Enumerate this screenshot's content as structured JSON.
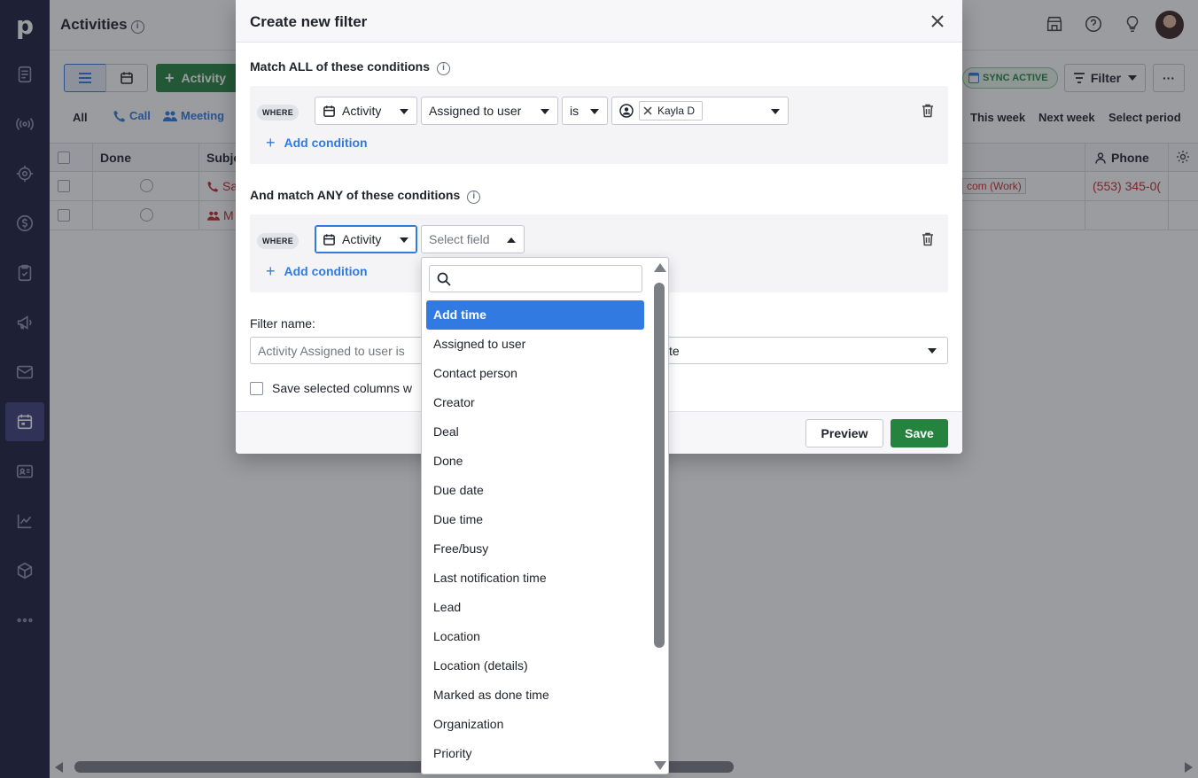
{
  "app": {
    "page_title": "Activities",
    "nav_icons": [
      "logo",
      "deals-icon",
      "leads-icon",
      "projects-icon",
      "revenue-icon",
      "tasks-icon",
      "campaigns-icon",
      "mail-icon",
      "activities-icon",
      "contacts-icon",
      "insights-icon",
      "products-icon",
      "more-icon"
    ],
    "toolbar": {
      "add_activity_label": "Activity",
      "sync_label": "SYNC ACTIVE",
      "filter_label": "Filter",
      "more_label": "···"
    },
    "filter_row": {
      "all_label": "All",
      "call_label": "Call",
      "meeting_label": "Meeting",
      "this_week": "This week",
      "next_week": "Next week",
      "select_period": "Select period"
    },
    "table": {
      "headers": {
        "done": "Done",
        "subject": "Subje",
        "phone": "Phone"
      },
      "rows": [
        {
          "subject": "Sa",
          "email": "com (Work)",
          "phone": "(553) 345-0("
        },
        {
          "subject": "M",
          "email": "",
          "phone": ""
        }
      ]
    }
  },
  "modal": {
    "title": "Create new filter",
    "all_section_title": "Match ALL of these conditions",
    "any_section_title": "And match ANY of these conditions",
    "where_label": "WHERE",
    "all_condition": {
      "entity": "Activity",
      "field": "Assigned to user",
      "operator": "is",
      "value_user": "Kayla D"
    },
    "any_condition": {
      "entity": "Activity",
      "field_placeholder": "Select field"
    },
    "add_condition_label": "Add condition",
    "filter_name_label": "Filter name:",
    "filter_name_value": "Activity Assigned to user is",
    "visibility_value": "te",
    "save_columns_label": "Save selected columns w",
    "preview_label": "Preview",
    "save_label": "Save"
  },
  "dropdown": {
    "search_value": "",
    "items": [
      "Add time",
      "Assigned to user",
      "Contact person",
      "Creator",
      "Deal",
      "Done",
      "Due date",
      "Due time",
      "Free/busy",
      "Last notification time",
      "Lead",
      "Location",
      "Location (details)",
      "Marked as done time",
      "Organization",
      "Priority"
    ],
    "highlighted_index": 0
  },
  "colors": {
    "accent_blue": "#317ae2",
    "brand_green": "#26833f",
    "nav_bg": "#1d1e3c"
  }
}
